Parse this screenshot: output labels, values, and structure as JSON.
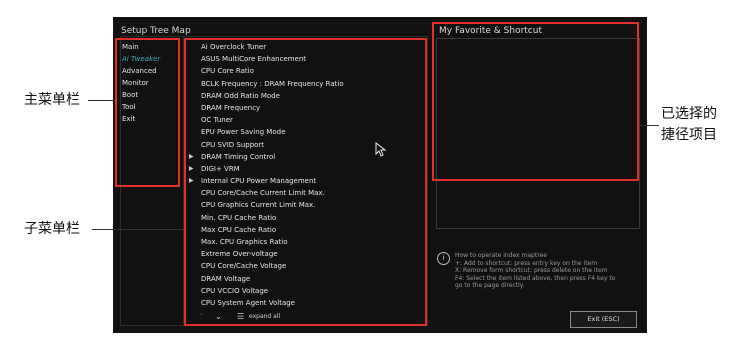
{
  "screen": {
    "tree_title": "Setup Tree Map",
    "favorite_title": "My Favorite & Shortcut"
  },
  "main_menu": {
    "items": [
      {
        "label": "Main",
        "active": false
      },
      {
        "label": "Ai Tweaker",
        "active": true
      },
      {
        "label": "Advanced",
        "active": false
      },
      {
        "label": "Monitor",
        "active": false
      },
      {
        "label": "Boot",
        "active": false
      },
      {
        "label": "Tool",
        "active": false
      },
      {
        "label": "Exit",
        "active": false
      }
    ]
  },
  "submenu": {
    "items": [
      {
        "label": "Ai Overclock Tuner",
        "arrow": false
      },
      {
        "label": "ASUS MultiCore Enhancement",
        "arrow": false
      },
      {
        "label": "CPU Core Ratio",
        "arrow": false
      },
      {
        "label": "BCLK Frequency : DRAM Frequency Ratio",
        "arrow": false
      },
      {
        "label": "DRAM Odd Ratio Mode",
        "arrow": false
      },
      {
        "label": "DRAM Frequency",
        "arrow": false
      },
      {
        "label": "OC Tuner",
        "arrow": false
      },
      {
        "label": "EPU Power Saving Mode",
        "arrow": false
      },
      {
        "label": "CPU SVID Support",
        "arrow": false
      },
      {
        "label": "DRAM Timing Control",
        "arrow": true
      },
      {
        "label": "DIGI+ VRM",
        "arrow": true
      },
      {
        "label": "Internal CPU Power Management",
        "arrow": true
      },
      {
        "label": "CPU Core/Cache Current Limit Max.",
        "arrow": false
      },
      {
        "label": "CPU Graphics Current Limit Max.",
        "arrow": false
      },
      {
        "label": "Min. CPU Cache Ratio",
        "arrow": false
      },
      {
        "label": "Max CPU Cache Ratio",
        "arrow": false
      },
      {
        "label": "Max. CPU Graphics Ratio",
        "arrow": false
      },
      {
        "label": "Extreme Over-voltage",
        "arrow": false
      },
      {
        "label": "CPU Core/Cache Voltage",
        "arrow": false
      },
      {
        "label": "DRAM Voltage",
        "arrow": false
      },
      {
        "label": "CPU VCCIO Voltage",
        "arrow": false
      },
      {
        "label": "CPU System Agent Voltage",
        "arrow": false
      }
    ],
    "expand_all_label": "expand all"
  },
  "help": {
    "lines": [
      "How to operate index maptree",
      "+: Add to shortcut: press entry key on the item",
      "X: Remove form shortcut: press delete on the item",
      "F4: Select the item listed above, then press F4 key to",
      "go to the page directly."
    ]
  },
  "exit_button_label": "Exit (ESC)",
  "annotations": {
    "main_menu_bar": "主菜单栏",
    "sub_menu_bar": "子菜单栏",
    "selected_line1": "已选择的",
    "selected_line2": "捷径项目"
  },
  "colors": {
    "highlight_red": "#e0302a",
    "active_menu": "#3fa7b5",
    "screen_bg": "#111111"
  }
}
